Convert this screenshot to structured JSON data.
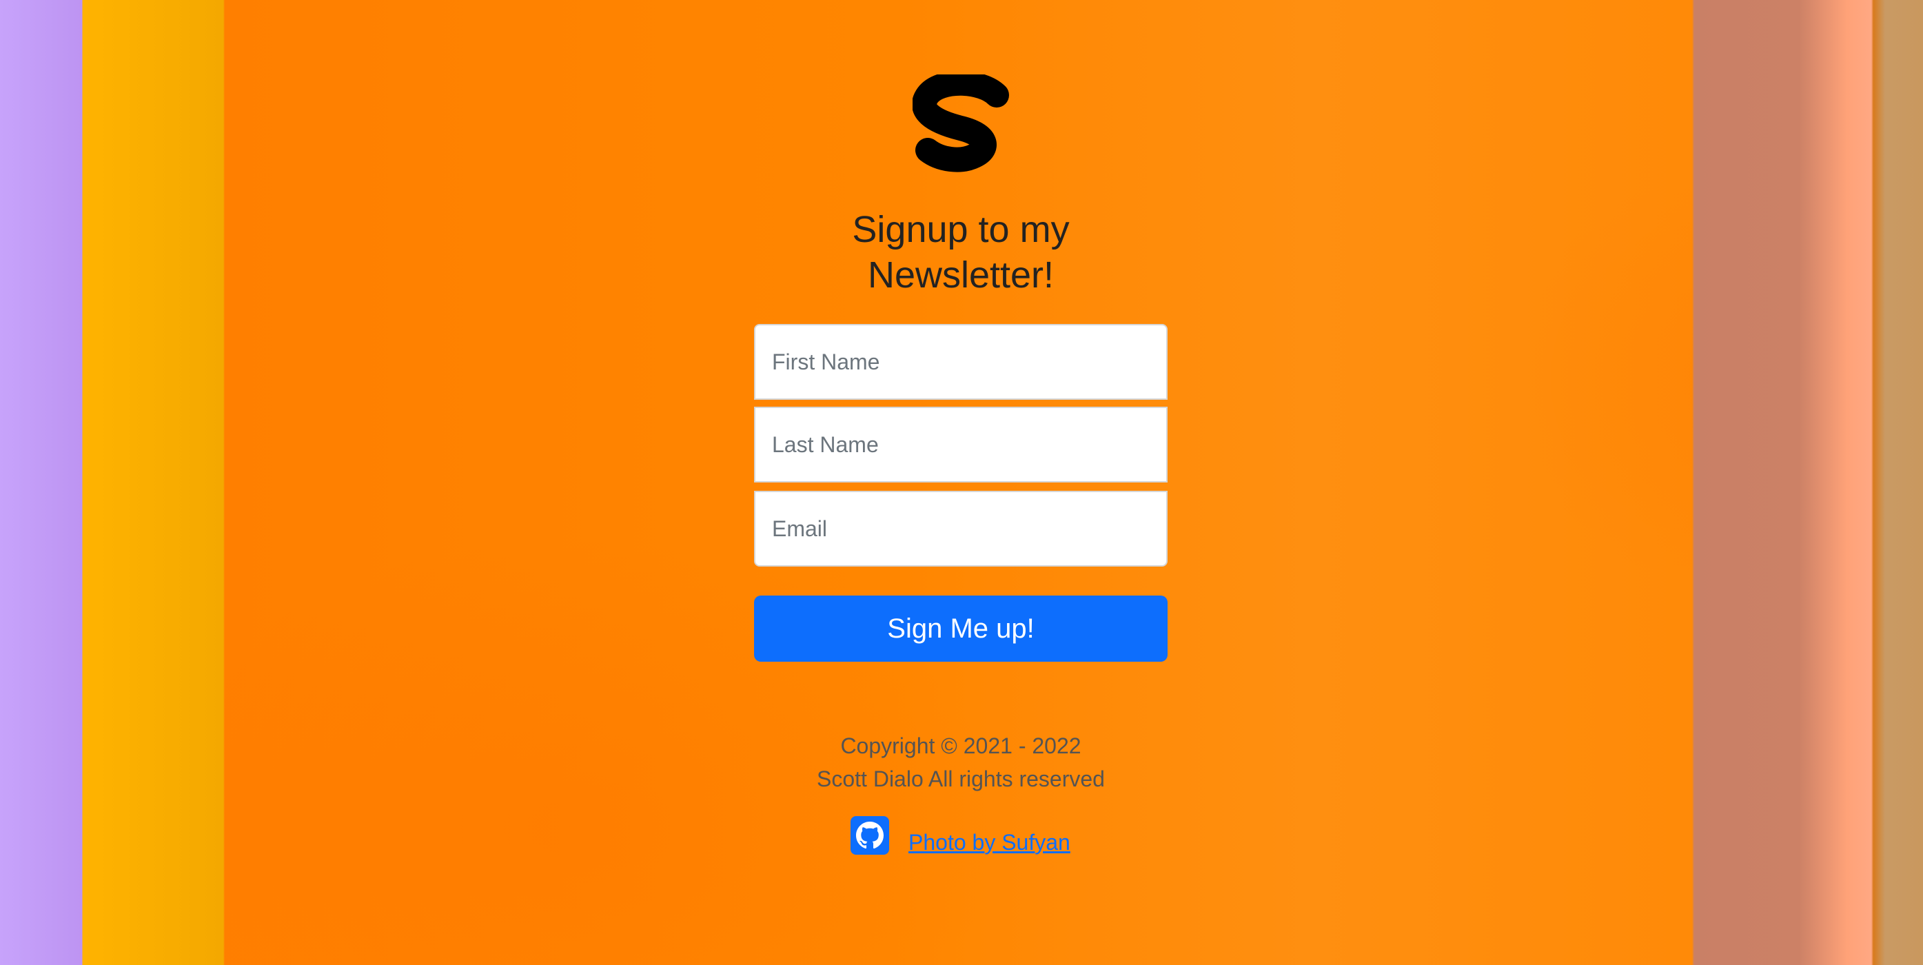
{
  "colors": {
    "accent": "#0d6efd",
    "background": "#ff8400",
    "title_text": "#222222",
    "footer_text": "#545454"
  },
  "logo": {
    "icon": "s-logo-icon"
  },
  "heading": {
    "line1": "Signup to my",
    "line2": "Newsletter!"
  },
  "form": {
    "first_name_placeholder": "First Name",
    "last_name_placeholder": "Last Name",
    "email_placeholder": "Email",
    "submit_label": "Sign Me up!"
  },
  "footer": {
    "copyright": "Copyright © 2021 - 2022",
    "rights": "Scott Dialo All rights reserved",
    "github_icon": "github-icon",
    "photo_credit": "Photo by Sufyan"
  }
}
